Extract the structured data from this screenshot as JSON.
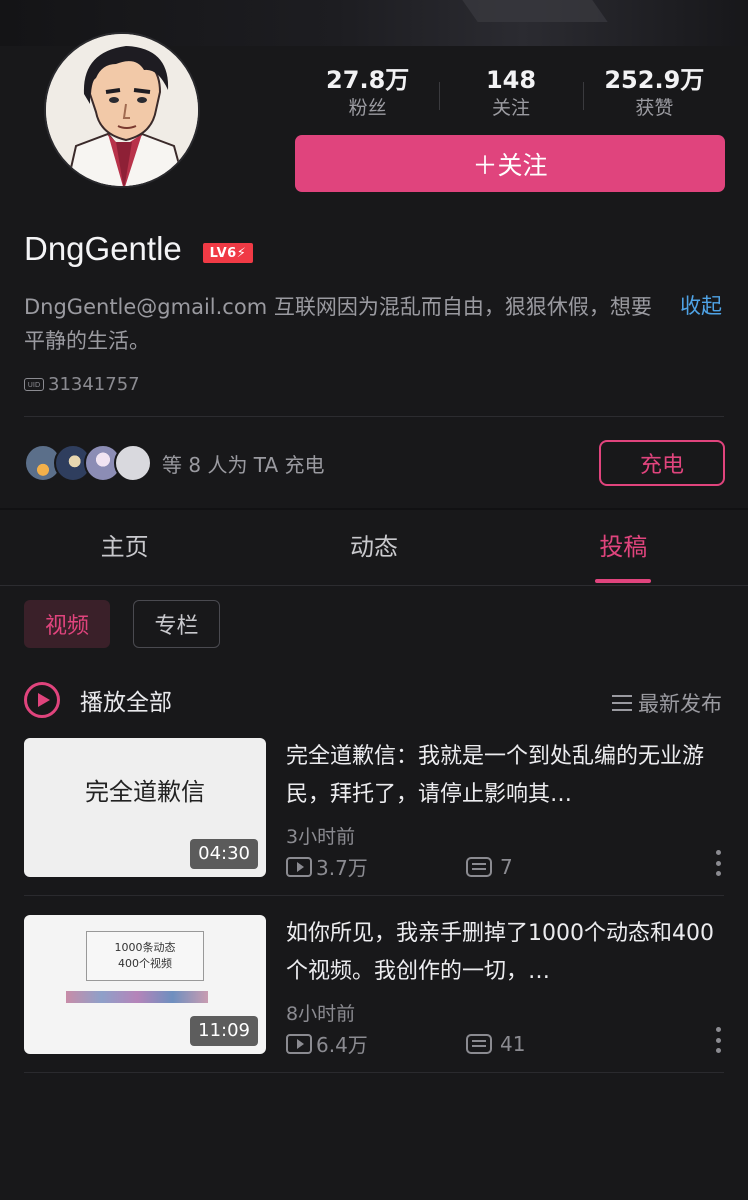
{
  "profile": {
    "username": "DngGentle",
    "level_badge": "LV6⚡",
    "bio": "DngGentle@gmail.com 互联网因为混乱而自由，狠狠休假，想要平静的生活。",
    "collapse_label": "收起",
    "uid_icon_text": "UID",
    "uid": "31341757"
  },
  "stats": [
    {
      "value": "27.8万",
      "label": "粉丝"
    },
    {
      "value": "148",
      "label": "关注"
    },
    {
      "value": "252.9万",
      "label": "获赞"
    }
  ],
  "follow_button": "＋关注",
  "charge": {
    "text": "等 8 人为 TA 充电",
    "button": "充电",
    "supporter_avatars": [
      "#5b6f8a",
      "#2f3e5e",
      "#8c8db5",
      "#d9d9de"
    ]
  },
  "tabs": [
    {
      "label": "主页",
      "active": false
    },
    {
      "label": "动态",
      "active": false
    },
    {
      "label": "投稿",
      "active": true
    }
  ],
  "filters": {
    "video": "视频",
    "column": "专栏"
  },
  "play_all": "播放全部",
  "sort": "最新发布",
  "videos": [
    {
      "thumb_text": "完全道歉信",
      "duration": "04:30",
      "title": "完全道歉信：我就是一个到处乱编的无业游民，拜托了，请停止影响其…",
      "time": "3小时前",
      "views": "3.7万",
      "comments": "7"
    },
    {
      "thumb_text_line1": "1000条动态",
      "thumb_text_line2": "400个视频",
      "duration": "11:09",
      "title": "如你所见，我亲手删掉了1000个动态和400个视频。我创作的一切，…",
      "time": "8小时前",
      "views": "6.4万",
      "comments": "41"
    }
  ],
  "colors": {
    "accent": "#e0447d",
    "link": "#4fa3e6",
    "background": "#18181a"
  }
}
